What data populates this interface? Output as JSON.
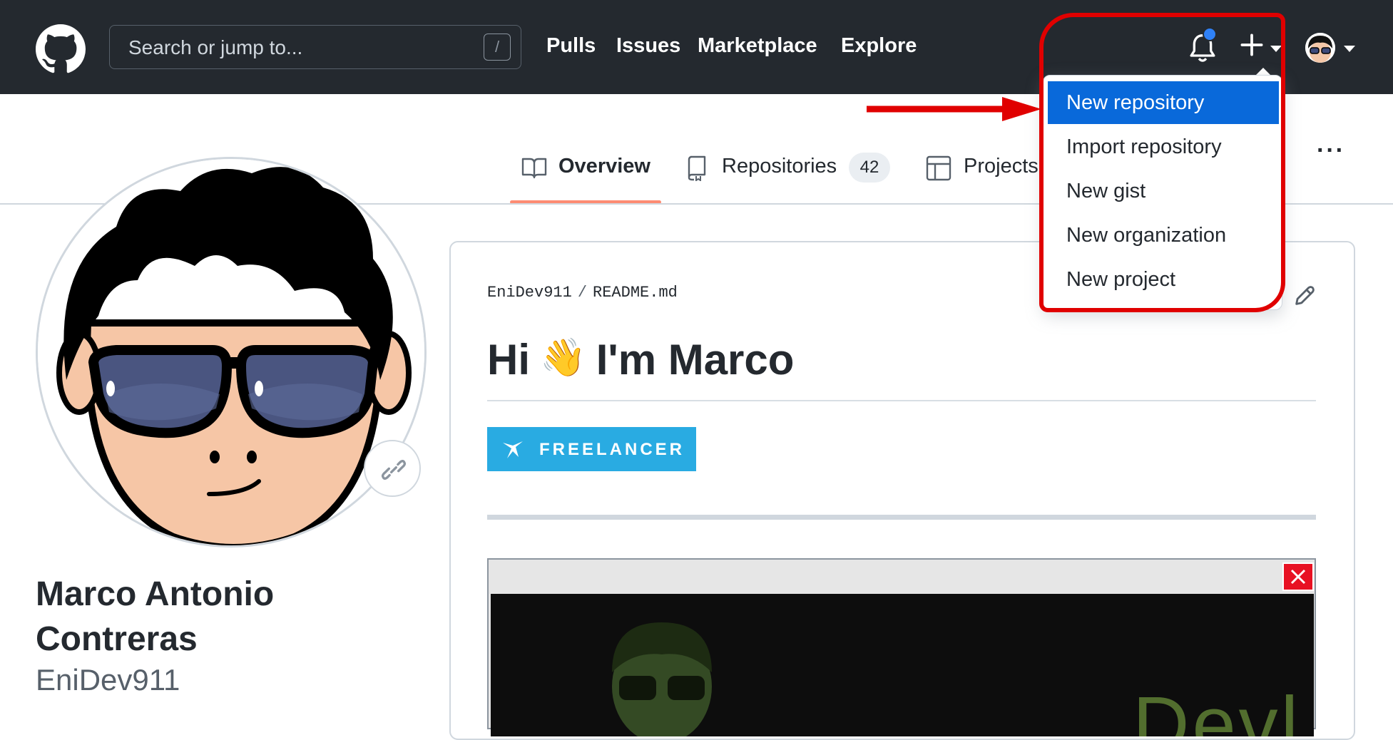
{
  "header": {
    "search_placeholder": "Search or jump to...",
    "search_shortcut": "/",
    "nav": [
      "Pulls",
      "Issues",
      "Marketplace",
      "Explore"
    ]
  },
  "create_menu": {
    "items": [
      "New repository",
      "Import repository",
      "New gist",
      "New organization",
      "New project"
    ],
    "highlighted_index": 0
  },
  "tabs": [
    {
      "label": "Overview",
      "selected": true
    },
    {
      "label": "Repositories",
      "count": "42"
    },
    {
      "label": "Projects"
    }
  ],
  "profile": {
    "name": "Marco Antonio Contreras",
    "login": "EniDev911"
  },
  "readme": {
    "owner": "EniDev911",
    "separator": "/",
    "file": "README.md",
    "title_hi": "Hi",
    "title_wave": "👋",
    "title_rest": "I'm Marco",
    "badge": "FREELANCER",
    "media_text": "Devl"
  },
  "colors": {
    "header_bg": "#24292f",
    "accent_blue": "#0969da",
    "tab_underline": "#fd8c73",
    "badge_bg": "#29abe2",
    "annotation_red": "#e00000"
  },
  "icons": [
    "github-logo-icon",
    "bell-icon",
    "plus-icon",
    "book-icon",
    "repo-icon",
    "table-icon",
    "link-icon",
    "pencil-icon",
    "close-icon",
    "fiverr-icon"
  ]
}
